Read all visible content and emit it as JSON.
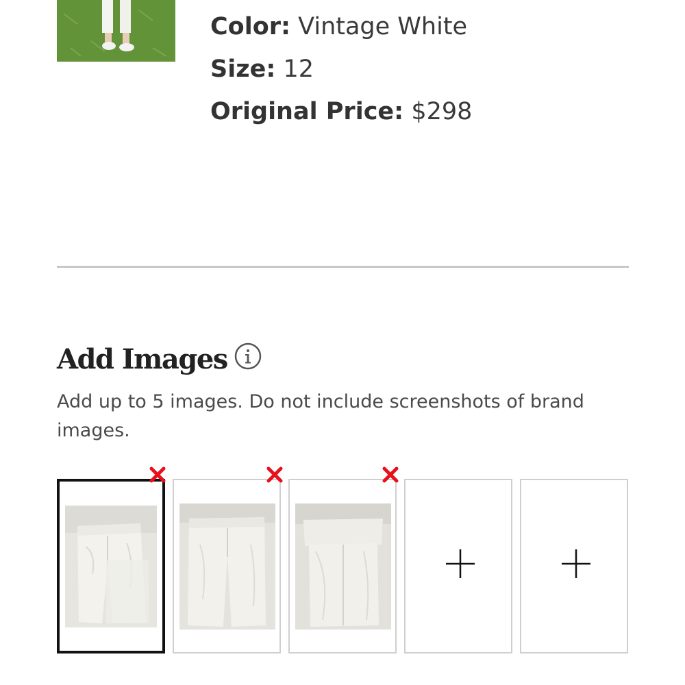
{
  "product": {
    "color_label": "Color:",
    "color_value": "Vintage White",
    "size_label": "Size:",
    "size_value": "12",
    "price_label": "Original Price:",
    "price_value": "$298",
    "thumbnail_icon": "product-photo"
  },
  "images_section": {
    "title": "Add Images",
    "info_icon": "info-icon",
    "instructions": "Add up to 5 images. Do not include screenshots of brand images.",
    "max_images": 5,
    "uploaded_count": 3,
    "selected_index": 0,
    "slots": [
      {
        "state": "uploaded",
        "remove_icon": "close-icon"
      },
      {
        "state": "uploaded",
        "remove_icon": "close-icon"
      },
      {
        "state": "uploaded",
        "remove_icon": "close-icon"
      },
      {
        "state": "empty",
        "add_icon": "plus-icon"
      },
      {
        "state": "empty",
        "add_icon": "plus-icon"
      }
    ]
  },
  "colors": {
    "remove_icon": "#e8101a",
    "selected_border": "#111111",
    "slot_border": "#cfcfcf",
    "divider": "#c8c8c8"
  }
}
